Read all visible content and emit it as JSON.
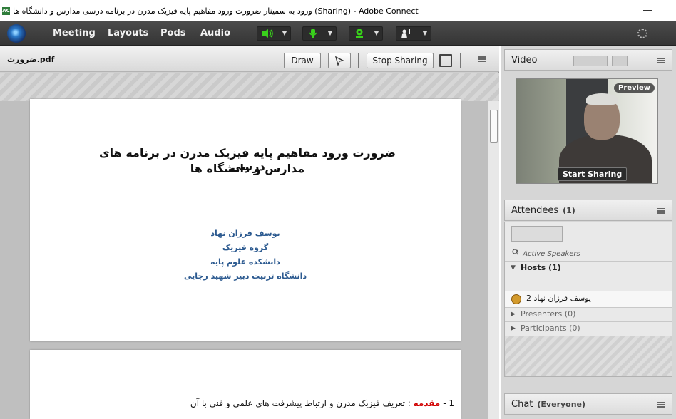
{
  "window": {
    "title": "ورود به سمینار ضرورت ورود مفاهیم پایه فیزیک مدرن در برنامه درسی مدارس و دانشگاه ها (Sharing) - Adobe Connect",
    "app_icon_label": "AC"
  },
  "menu": {
    "items": [
      "Meeting",
      "Layouts",
      "Pods",
      "Audio"
    ]
  },
  "share_pod": {
    "document_name": "ضرورت.pdf",
    "draw_label": "Draw",
    "stop_sharing_label": "Stop Sharing",
    "page1": {
      "title_line1": "ضرورت ورود مفاهیم پایه فیزیک مدرن در برنامه های درسی",
      "title_line2": "مدارس و دانشگاه ها",
      "author_lines": [
        "یوسف فرزان نهاد",
        "گروه فیزیک",
        "دانشکده علوم پایه",
        "دانشگاه تربیت دبیر شهید رجایی"
      ]
    },
    "page2": {
      "number": "1 -",
      "highlight": "مقدمه",
      "rest": ": تعریف فیزیک مدرن و ارتباط پیشرفت های علمی و فنی با آن"
    }
  },
  "video_pod": {
    "title": "Video",
    "preview_label": "Preview",
    "start_sharing_label": "Start Sharing"
  },
  "attendees_pod": {
    "title": "Attendees",
    "count": "(1)",
    "active_speakers_label": "Active Speakers",
    "hosts_label": "Hosts (1)",
    "host_name": "2 یوسف فرزان نهاد",
    "presenters_label": "Presenters (0)",
    "participants_label": "Participants (0)"
  },
  "chat_pod": {
    "title": "Chat",
    "scope": "(Everyone)"
  },
  "colors": {
    "menubar": "#3f3f3f",
    "audio_green": "#39d11b",
    "author_blue": "#2c5a90",
    "highlight_red": "#d10000"
  },
  "icons": [
    "app-icon",
    "logo-icon",
    "speaker-icon",
    "microphone-icon",
    "webcam-icon",
    "raise-hand-icon",
    "activity-spinner-icon",
    "fit-page-icon",
    "pod-menu-icon"
  ]
}
